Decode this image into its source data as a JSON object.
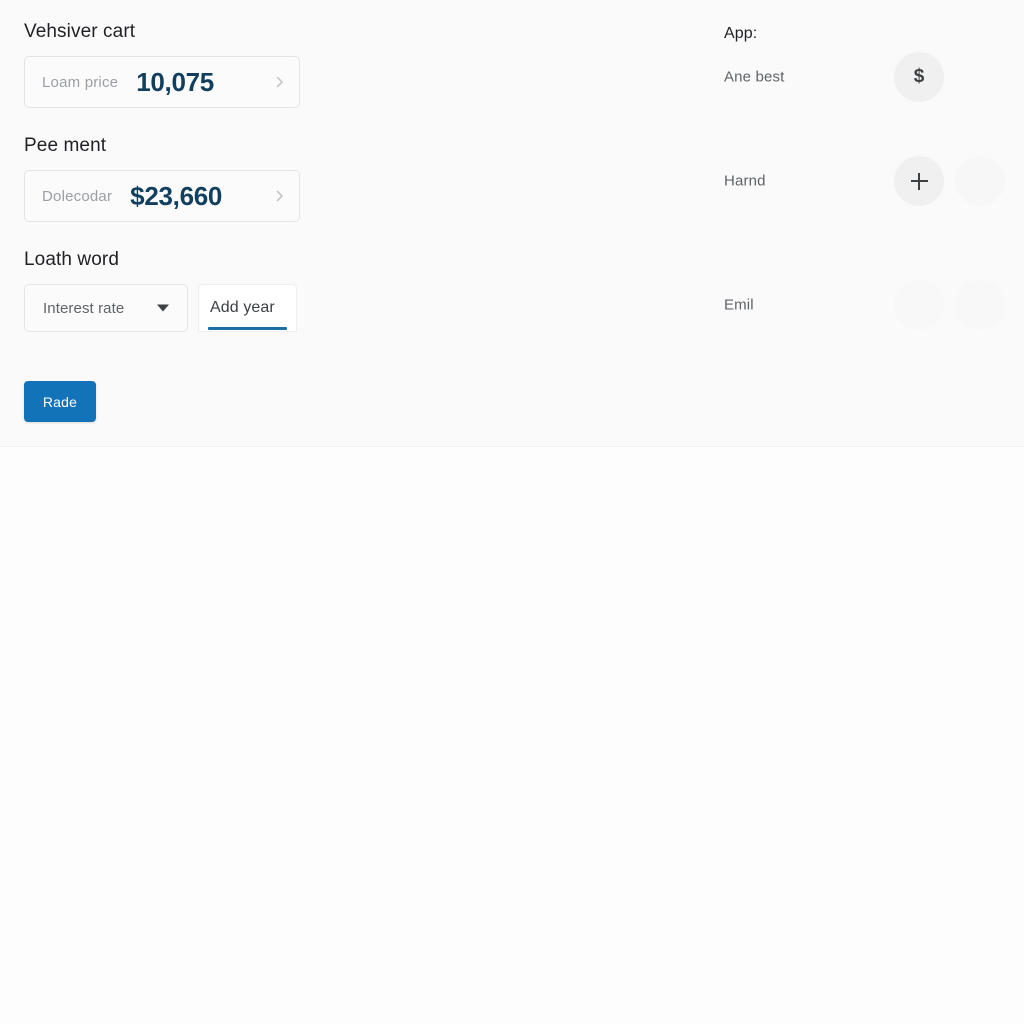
{
  "panel": {
    "background_color": "#fafafa"
  },
  "left": {
    "sections": [
      {
        "heading": "Vehsiver cart",
        "card": {
          "label": "Loam price",
          "amount": "10,075",
          "chevron_icon": "chevron-right-icon"
        }
      },
      {
        "heading": "Pee ment",
        "card": {
          "label": "Dolecodar",
          "amount": "$23,660",
          "chevron_icon": "chevron-right-icon"
        }
      }
    ],
    "loan_section": {
      "heading": "Loath word",
      "select": {
        "selected": "Interest rate",
        "caret_icon": "chevron-down-icon",
        "options": [
          "Interest rate"
        ]
      },
      "year_field": {
        "value": "Add year",
        "placeholder": "Add year"
      }
    },
    "submit_button": {
      "label": "Rade",
      "color": "#1273b8"
    }
  },
  "right": {
    "heading": "App:",
    "rows": [
      {
        "label": "Ane best",
        "action_icon": "dollar-icon",
        "action_glyph": "$"
      },
      {
        "label": "Harnd",
        "action_icon": "plus-icon",
        "action_glyph": "+"
      },
      {
        "label": "Emil",
        "action_icon": "hidden-icon",
        "action_glyph": ""
      }
    ]
  },
  "accent": {
    "primary": "#1273b8",
    "value_text": "#123f5e",
    "underline": "#1d6ea5",
    "muted_text": "#9b9fa4"
  }
}
